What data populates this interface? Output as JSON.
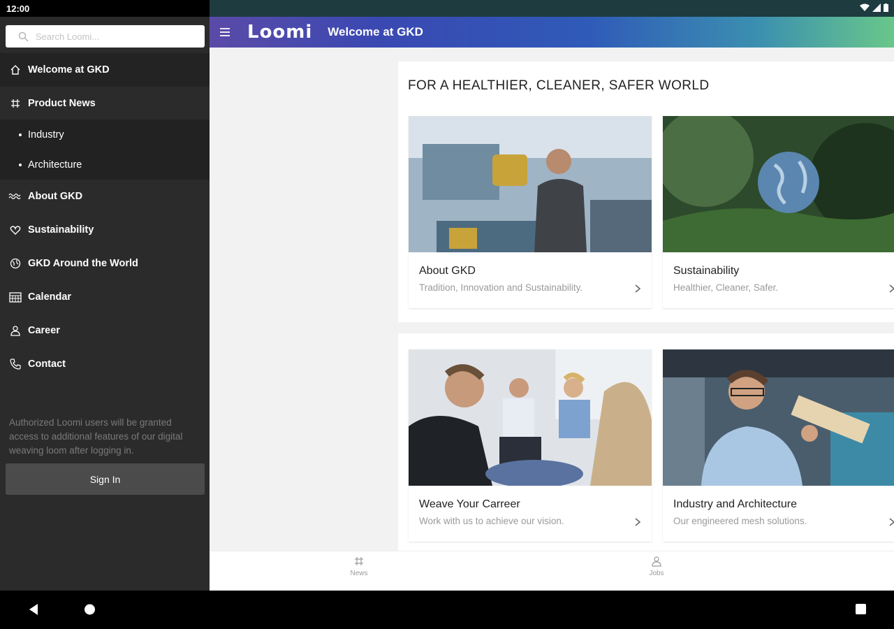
{
  "status": {
    "time": "12:00"
  },
  "sidebar": {
    "search_placeholder": "Search Loomi...",
    "items": [
      {
        "label": "Welcome at GKD",
        "icon": "home-icon"
      },
      {
        "label": "Product News",
        "icon": "hashtag-icon"
      },
      {
        "label": "Industry",
        "icon": "bullet"
      },
      {
        "label": "Architecture",
        "icon": "bullet"
      },
      {
        "label": "About GKD",
        "icon": "mesh-icon"
      },
      {
        "label": "Sustainability",
        "icon": "heart-icon"
      },
      {
        "label": "GKD Around the World",
        "icon": "globe-icon"
      },
      {
        "label": "Calendar",
        "icon": "calendar-icon"
      },
      {
        "label": "Career",
        "icon": "person-icon"
      },
      {
        "label": "Contact",
        "icon": "phone-icon"
      }
    ],
    "note": "Authorized Loomi users will be granted access to additional features of our digital weaving loom after logging in.",
    "signin_label": "Sign In"
  },
  "header": {
    "logo": "Loomi",
    "title": "Welcome at GKD"
  },
  "main": {
    "headline": "FOR A HEALTHIER, CLEANER, SAFER WORLD",
    "cards": [
      {
        "title": "About GKD",
        "subtitle": "Tradition, Innovation and Sustainability."
      },
      {
        "title": "Sustainability",
        "subtitle": "Healthier, Cleaner, Safer."
      },
      {
        "title": "Weave Your Carreer",
        "subtitle": "Work with us to achieve our vision."
      },
      {
        "title": "Industry and Architecture",
        "subtitle": "Our engineered mesh solutions."
      }
    ]
  },
  "tabs": [
    {
      "label": "News",
      "icon": "hashtag-icon"
    },
    {
      "label": "Jobs",
      "icon": "person-icon"
    }
  ],
  "colors": {
    "sidebar_bg": "#2b2b2b",
    "header_gradient_start": "#5a4aa8",
    "header_gradient_end": "#69c78a"
  }
}
